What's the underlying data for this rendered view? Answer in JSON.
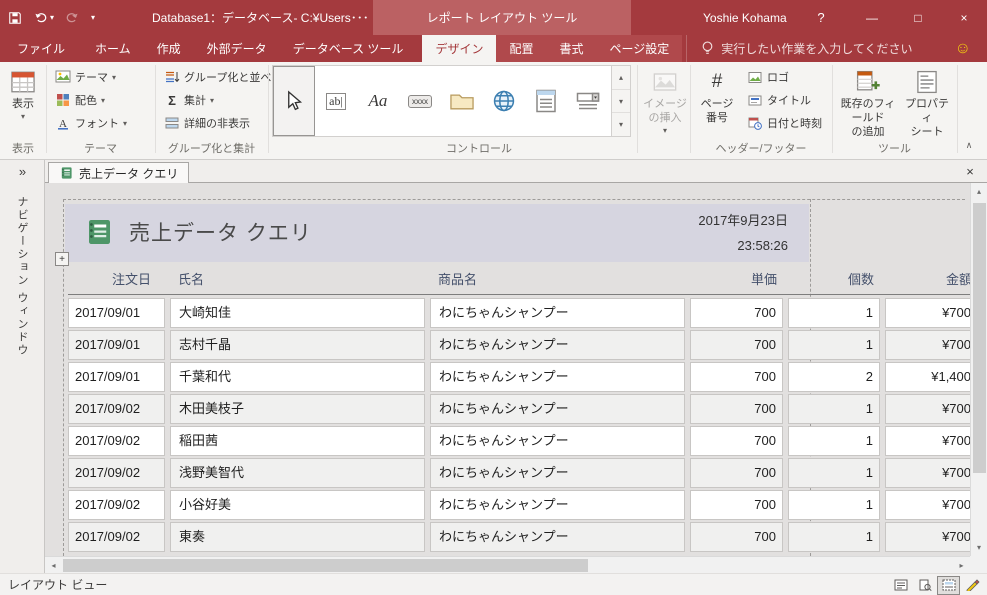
{
  "colors": {
    "accent": "#A4373A",
    "titlebar": "#A43A3E",
    "titlebar_context": "#BB6163",
    "ctx_tabs": "#B0494C",
    "band": "#D6D5E0",
    "row_alt": "#F0F0EF"
  },
  "glyphs": {
    "dropdown": "▾",
    "up": "▴",
    "left": "◂",
    "right": "▸",
    "sigma": "Σ",
    "hash": "#",
    "textbox": "ab|",
    "label_glyph": "Aa",
    "button_glyph": "xxxx",
    "expand_nav": "»",
    "close": "×",
    "minimize": "—",
    "maximize": "□",
    "smiley": "☺",
    "collapse": "∧",
    "plus": "+"
  },
  "titlebar": {
    "title": "Database1：データベース- C:¥Users･･･",
    "context_tool_label": "レポート レイアウト ツール",
    "user_name": "Yoshie Kohama",
    "help_label": "?"
  },
  "tabs": {
    "file": "ファイル",
    "items": [
      "ホーム",
      "作成",
      "外部データ",
      "データベース ツール"
    ],
    "contextual": [
      "デザイン",
      "配置",
      "書式",
      "ページ設定"
    ],
    "active": "デザイン",
    "tell_me": "実行したい作業を入力してください"
  },
  "ribbon": {
    "view_button": "表示",
    "themes": {
      "items": [
        "テーマ",
        "配色",
        "フォント"
      ]
    },
    "grouping": {
      "items": [
        "グループ化と並べ替え",
        "集計",
        "詳細の非表示"
      ]
    },
    "controls": {
      "insert_image": [
        "イメージ",
        "の挿入"
      ]
    },
    "header_footer": {
      "page_number": [
        "ページ",
        "番号"
      ],
      "logo": "ロゴ",
      "title": "タイトル",
      "datetime": "日付と時刻"
    },
    "tools": {
      "add_fields": [
        "既存のフィールド",
        "の追加"
      ],
      "property_sheet": [
        "プロパティ",
        "シート"
      ]
    },
    "groups": {
      "view": "表示",
      "themes": "テーマ",
      "grouping": "グループ化と集計",
      "controls": "コントロール",
      "header_footer": "ヘッダー/フッター",
      "tools": "ツール"
    }
  },
  "document": {
    "tab_label": "売上データ クエリ"
  },
  "nav_pane": {
    "label": "ナビゲーション ウィンドウ"
  },
  "report": {
    "title": "売上データ クエリ",
    "date": "2017年9月23日",
    "time": "23:58:26",
    "columns": [
      "注文日",
      "氏名",
      "商品名",
      "単価",
      "個数",
      "金額"
    ],
    "rows": [
      [
        "2017/09/01",
        "大崎知佳",
        "わにちゃんシャンプー",
        "700",
        "1",
        "¥700"
      ],
      [
        "2017/09/01",
        "志村千晶",
        "わにちゃんシャンプー",
        "700",
        "1",
        "¥700"
      ],
      [
        "2017/09/01",
        "千葉和代",
        "わにちゃんシャンプー",
        "700",
        "2",
        "¥1,400"
      ],
      [
        "2017/09/02",
        "木田美枝子",
        "わにちゃんシャンプー",
        "700",
        "1",
        "¥700"
      ],
      [
        "2017/09/02",
        "稲田茜",
        "わにちゃんシャンプー",
        "700",
        "1",
        "¥700"
      ],
      [
        "2017/09/02",
        "浅野美智代",
        "わにちゃんシャンプー",
        "700",
        "1",
        "¥700"
      ],
      [
        "2017/09/02",
        "小谷好美",
        "わにちゃんシャンプー",
        "700",
        "1",
        "¥700"
      ],
      [
        "2017/09/02",
        "東奏",
        "わにちゃんシャンプー",
        "700",
        "1",
        "¥700"
      ]
    ]
  },
  "statusbar": {
    "view_label": "レイアウト ビュー"
  }
}
